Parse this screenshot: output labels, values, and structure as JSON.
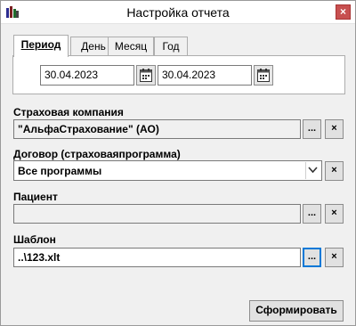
{
  "window": {
    "title": "Настройка отчета",
    "close_label": "×"
  },
  "tabs": [
    {
      "label": "Период",
      "active": true
    },
    {
      "label": "День"
    },
    {
      "label": "Месяц"
    },
    {
      "label": "Год"
    }
  ],
  "period": {
    "date_from": "30.04.2023",
    "date_to": "30.04.2023"
  },
  "insurance_company": {
    "label": "Страховая компания",
    "value": "\"АльфаСтрахование\" (АО)"
  },
  "contract": {
    "label": "Договор (страховаяпрограмма)",
    "value": "Все программы"
  },
  "patient": {
    "label": "Пациент",
    "value": ""
  },
  "template": {
    "label": "Шаблон",
    "value": "..\\123.xlt"
  },
  "buttons": {
    "browse": "...",
    "clear": "×",
    "submit": "Сформировать"
  },
  "colors": {
    "close_button": "#c75050",
    "focus_border": "#0078d7"
  }
}
